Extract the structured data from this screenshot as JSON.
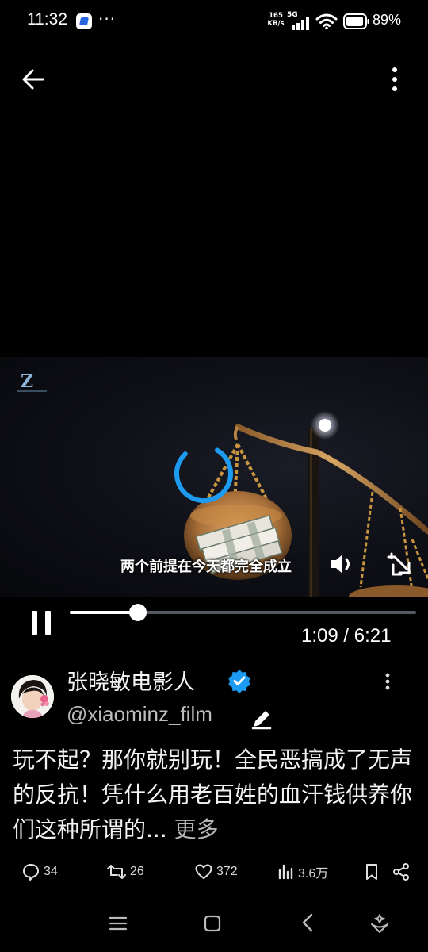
{
  "status_bar": {
    "time": "11:32",
    "more_indicator": "···",
    "net_speed_value": "165",
    "net_speed_unit": "KB/s",
    "network_type": "5G",
    "battery_percent": "89%"
  },
  "nav": {
    "back_icon": "arrow-left-icon",
    "overflow_icon": "vertical-dots-icon"
  },
  "video": {
    "subtitle": "两个前提在今天都完全成立",
    "progress_fraction": 0.197,
    "time_display": "1:09 / 6:21",
    "channel_logo_letter": "Z"
  },
  "author": {
    "display_name": "张晓敏电影人",
    "handle": "@xiaominz_film",
    "verified_color": "#1d9bf0"
  },
  "post": {
    "text": "玩不起？那你就别玩！全民恶搞成了无声的反抗！凭什么用老百姓的血汗钱供养你们这种所谓的",
    "ellipsis": "...",
    "more_label": "更多"
  },
  "actions": {
    "replies": "34",
    "retweets": "26",
    "likes": "372",
    "views": "3.6万"
  },
  "colors": {
    "accent": "#1d9bf0",
    "spinner": "#1d9bf0",
    "background": "#000000"
  }
}
